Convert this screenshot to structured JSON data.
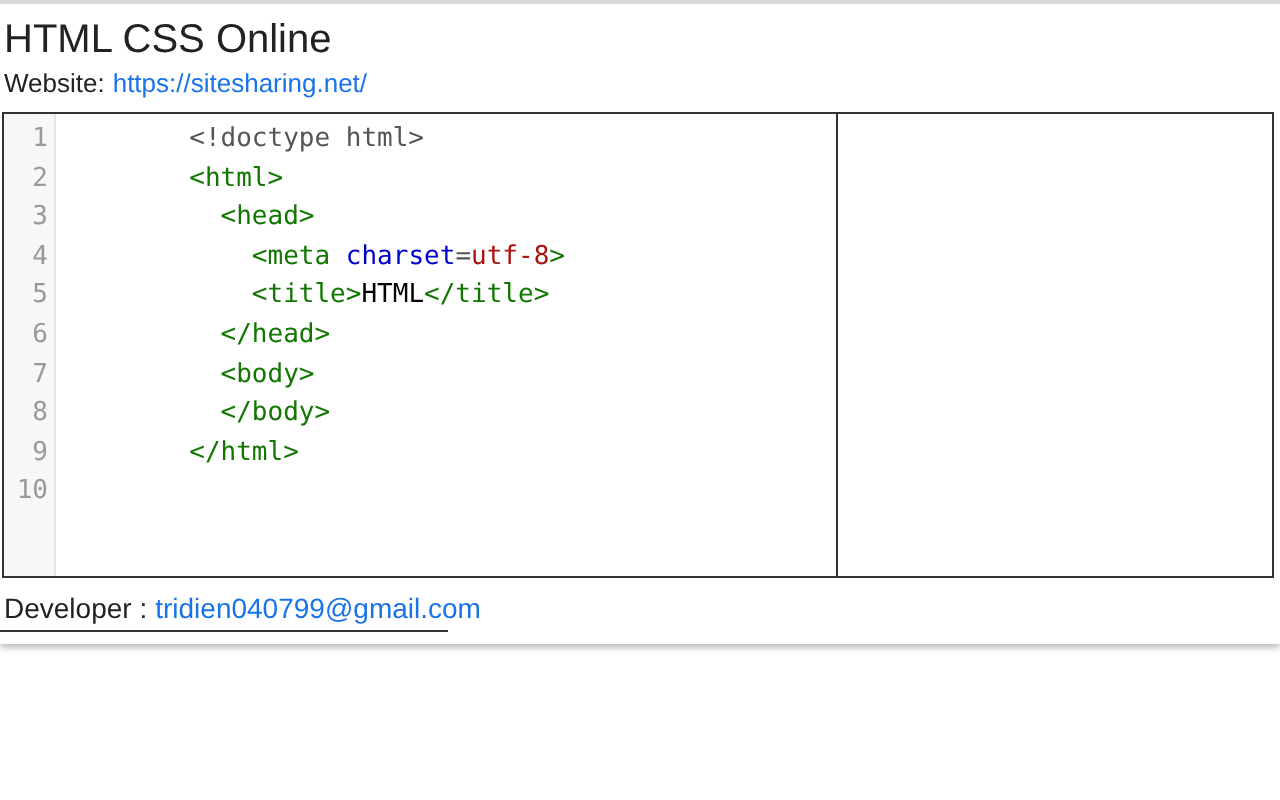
{
  "header": {
    "title": "HTML CSS Online",
    "website_label": "Website:",
    "website_link": "https://sitesharing.net/"
  },
  "editor": {
    "lines": [
      {
        "number": "1",
        "tokens": [
          {
            "kind": "plain",
            "text": "        <!doctype html>"
          }
        ]
      },
      {
        "number": "2",
        "tokens": [
          {
            "kind": "tag",
            "text": "        <html>"
          }
        ]
      },
      {
        "number": "3",
        "tokens": [
          {
            "kind": "tag",
            "text": "          <head>"
          }
        ]
      },
      {
        "number": "4",
        "tokens": [
          {
            "kind": "tag",
            "text": "            <meta "
          },
          {
            "kind": "attribute",
            "text": "charset"
          },
          {
            "kind": "plain",
            "text": "="
          },
          {
            "kind": "value",
            "text": "utf-8"
          },
          {
            "kind": "tag",
            "text": ">"
          }
        ]
      },
      {
        "number": "5",
        "tokens": [
          {
            "kind": "tag",
            "text": "            <title>"
          },
          {
            "kind": "content",
            "text": "HTML"
          },
          {
            "kind": "tag",
            "text": "</title>"
          }
        ]
      },
      {
        "number": "6",
        "tokens": [
          {
            "kind": "tag",
            "text": "          </head>"
          }
        ]
      },
      {
        "number": "7",
        "tokens": [
          {
            "kind": "tag",
            "text": "          <body>"
          }
        ]
      },
      {
        "number": "8",
        "tokens": [
          {
            "kind": "tag",
            "text": "          </body>"
          }
        ]
      },
      {
        "number": "9",
        "tokens": [
          {
            "kind": "tag",
            "text": "        </html>"
          }
        ]
      },
      {
        "number": "10"
      }
    ]
  },
  "footer": {
    "developer_label": "Developer :",
    "developer_email": "tridien040799@gmail.com"
  }
}
